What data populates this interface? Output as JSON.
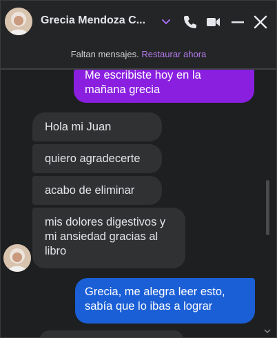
{
  "header": {
    "title": "Grecia Mendoza C...",
    "icons": [
      "chevron-down-icon",
      "phone-icon",
      "video-icon",
      "minimize-icon",
      "close-icon"
    ],
    "accent": "#a56cf0"
  },
  "banner": {
    "text": "Faltan mensajes. ",
    "link": "Restaurar ahora"
  },
  "messages": [
    {
      "direction": "outgoing",
      "color": "#8a1fe0",
      "text": "Me escribiste hoy en la mañana grecia"
    },
    {
      "direction": "incoming",
      "text": "Hola mi Juan"
    },
    {
      "direction": "incoming",
      "text": "quiero agradecerte"
    },
    {
      "direction": "incoming",
      "text": "acabo de eliminar"
    },
    {
      "direction": "incoming",
      "text": "mis dolores digestivos y mi ansiedad gracias al libro"
    },
    {
      "direction": "outgoing",
      "color": "#1a5fd6",
      "text": "Grecia, me alegra leer esto, sabía que lo ibas a lograr"
    }
  ]
}
